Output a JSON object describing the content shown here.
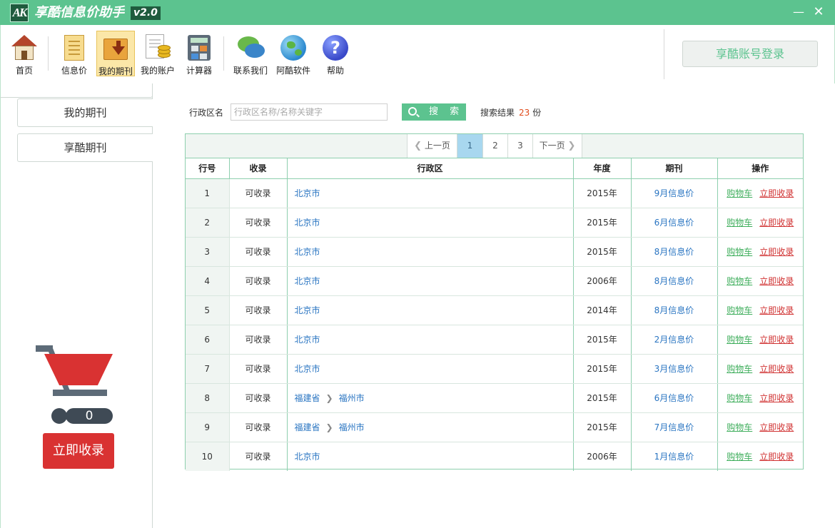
{
  "window": {
    "logo_text": "AK",
    "title": "享酷信息价助手",
    "version": "v2.0",
    "minimize": "—",
    "close": "✕"
  },
  "toolbar": {
    "items": [
      {
        "label": "首页",
        "icon": "home-icon"
      },
      {
        "label": "信息价",
        "icon": "document-icon"
      },
      {
        "label": "我的期刊",
        "icon": "download-folder-icon"
      },
      {
        "label": "我的账户",
        "icon": "account-coins-icon"
      },
      {
        "label": "计算器",
        "icon": "calculator-icon"
      },
      {
        "label": "联系我们",
        "icon": "chat-bubbles-icon"
      },
      {
        "label": "阿酷软件",
        "icon": "globe-icon"
      },
      {
        "label": "帮助",
        "icon": "help-icon"
      }
    ],
    "active": "我的期刊",
    "help_glyph": "?",
    "login_label": "享酷账号登录"
  },
  "sidebar": {
    "tabs": [
      "我的期刊",
      "享酷期刊"
    ],
    "cart_count": "0",
    "collect_button": "立即收录"
  },
  "search": {
    "label": "行政区名",
    "placeholder": "行政区名称/名称关键字",
    "button": "搜 索",
    "result_prefix": "搜索结果",
    "result_count": "23",
    "result_suffix": "份"
  },
  "pager": {
    "prev": "上一页",
    "pages": [
      "1",
      "2",
      "3"
    ],
    "current": "1",
    "next": "下一页"
  },
  "table": {
    "columns": [
      "行号",
      "收录",
      "行政区",
      "年度",
      "期刊",
      "操作"
    ],
    "rows": [
      {
        "no": "1",
        "status": "可收录",
        "region": [
          "北京市"
        ],
        "year": "2015年",
        "issue": "9月信息价"
      },
      {
        "no": "2",
        "status": "可收录",
        "region": [
          "北京市"
        ],
        "year": "2015年",
        "issue": "6月信息价"
      },
      {
        "no": "3",
        "status": "可收录",
        "region": [
          "北京市"
        ],
        "year": "2015年",
        "issue": "8月信息价"
      },
      {
        "no": "4",
        "status": "可收录",
        "region": [
          "北京市"
        ],
        "year": "2006年",
        "issue": "8月信息价"
      },
      {
        "no": "5",
        "status": "可收录",
        "region": [
          "北京市"
        ],
        "year": "2014年",
        "issue": "8月信息价"
      },
      {
        "no": "6",
        "status": "可收录",
        "region": [
          "北京市"
        ],
        "year": "2015年",
        "issue": "2月信息价"
      },
      {
        "no": "7",
        "status": "可收录",
        "region": [
          "北京市"
        ],
        "year": "2015年",
        "issue": "3月信息价"
      },
      {
        "no": "8",
        "status": "可收录",
        "region": [
          "福建省",
          "福州市"
        ],
        "year": "2015年",
        "issue": "6月信息价"
      },
      {
        "no": "9",
        "status": "可收录",
        "region": [
          "福建省",
          "福州市"
        ],
        "year": "2015年",
        "issue": "7月信息价"
      },
      {
        "no": "10",
        "status": "可收录",
        "region": [
          "北京市"
        ],
        "year": "2006年",
        "issue": "1月信息价"
      }
    ],
    "action_cart": "购物车",
    "action_collect": "立即收录"
  },
  "colors": {
    "accent": "#5cc38f",
    "link": "#2a75c2",
    "danger": "#d93232"
  }
}
